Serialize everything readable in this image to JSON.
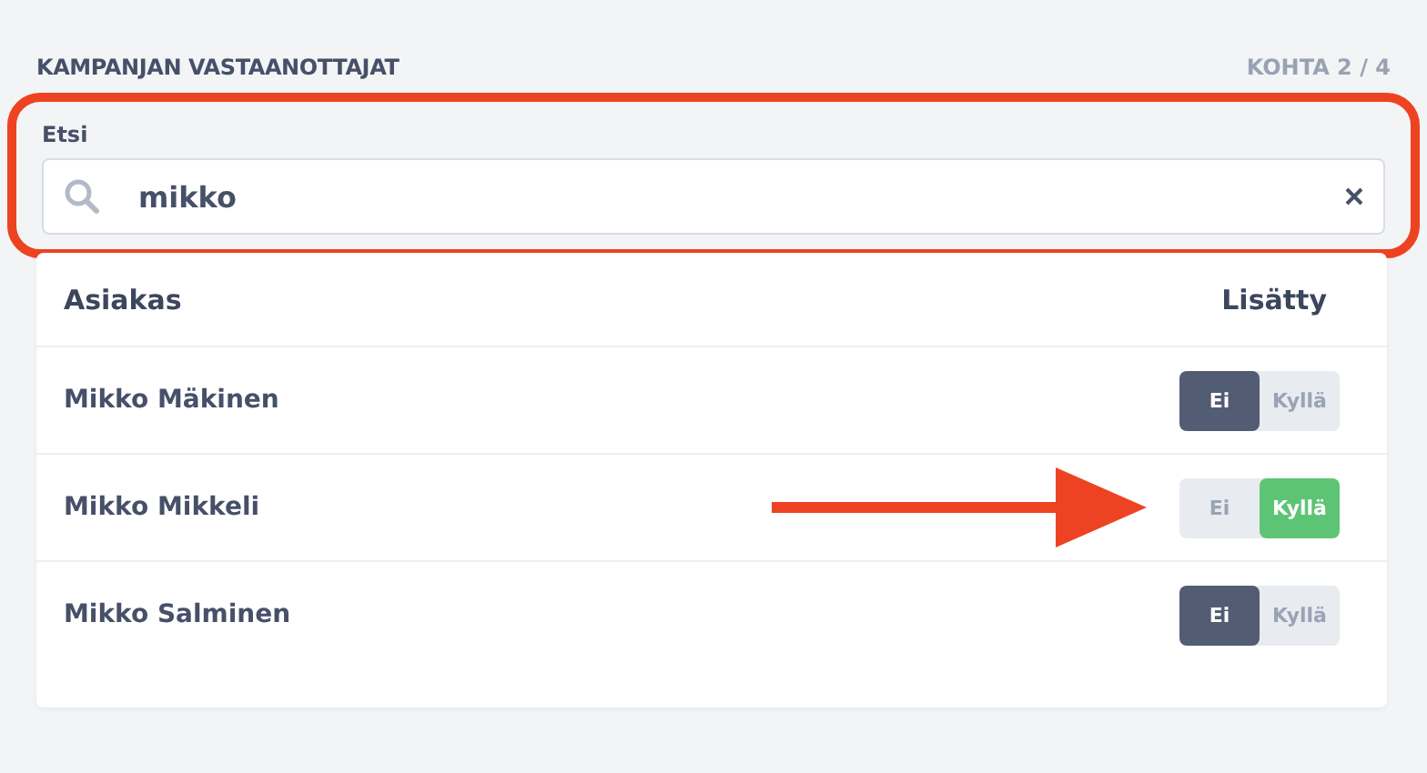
{
  "header": {
    "title": "KAMPANJAN VASTAANOTTAJAT",
    "step": "KOHTA 2 / 4"
  },
  "search": {
    "label": "Etsi",
    "value": "mikko",
    "highlighted": true
  },
  "table": {
    "columns": [
      "Asiakas",
      "Lisätty"
    ],
    "rows": [
      {
        "name": "Mikko Mäkinen",
        "arrow": false,
        "options": [
          {
            "label": "Ei",
            "kind": "no",
            "selected": true
          },
          {
            "label": "Kyllä",
            "kind": "yes",
            "selected": false
          }
        ]
      },
      {
        "name": "Mikko Mikkeli",
        "arrow": true,
        "options": [
          {
            "label": "Ei",
            "kind": "no",
            "selected": false
          },
          {
            "label": "Kyllä",
            "kind": "yes",
            "selected": true
          }
        ]
      },
      {
        "name": "Mikko Salminen",
        "arrow": false,
        "options": [
          {
            "label": "Ei",
            "kind": "no",
            "selected": true
          },
          {
            "label": "Kyllä",
            "kind": "yes",
            "selected": false
          }
        ]
      }
    ]
  }
}
